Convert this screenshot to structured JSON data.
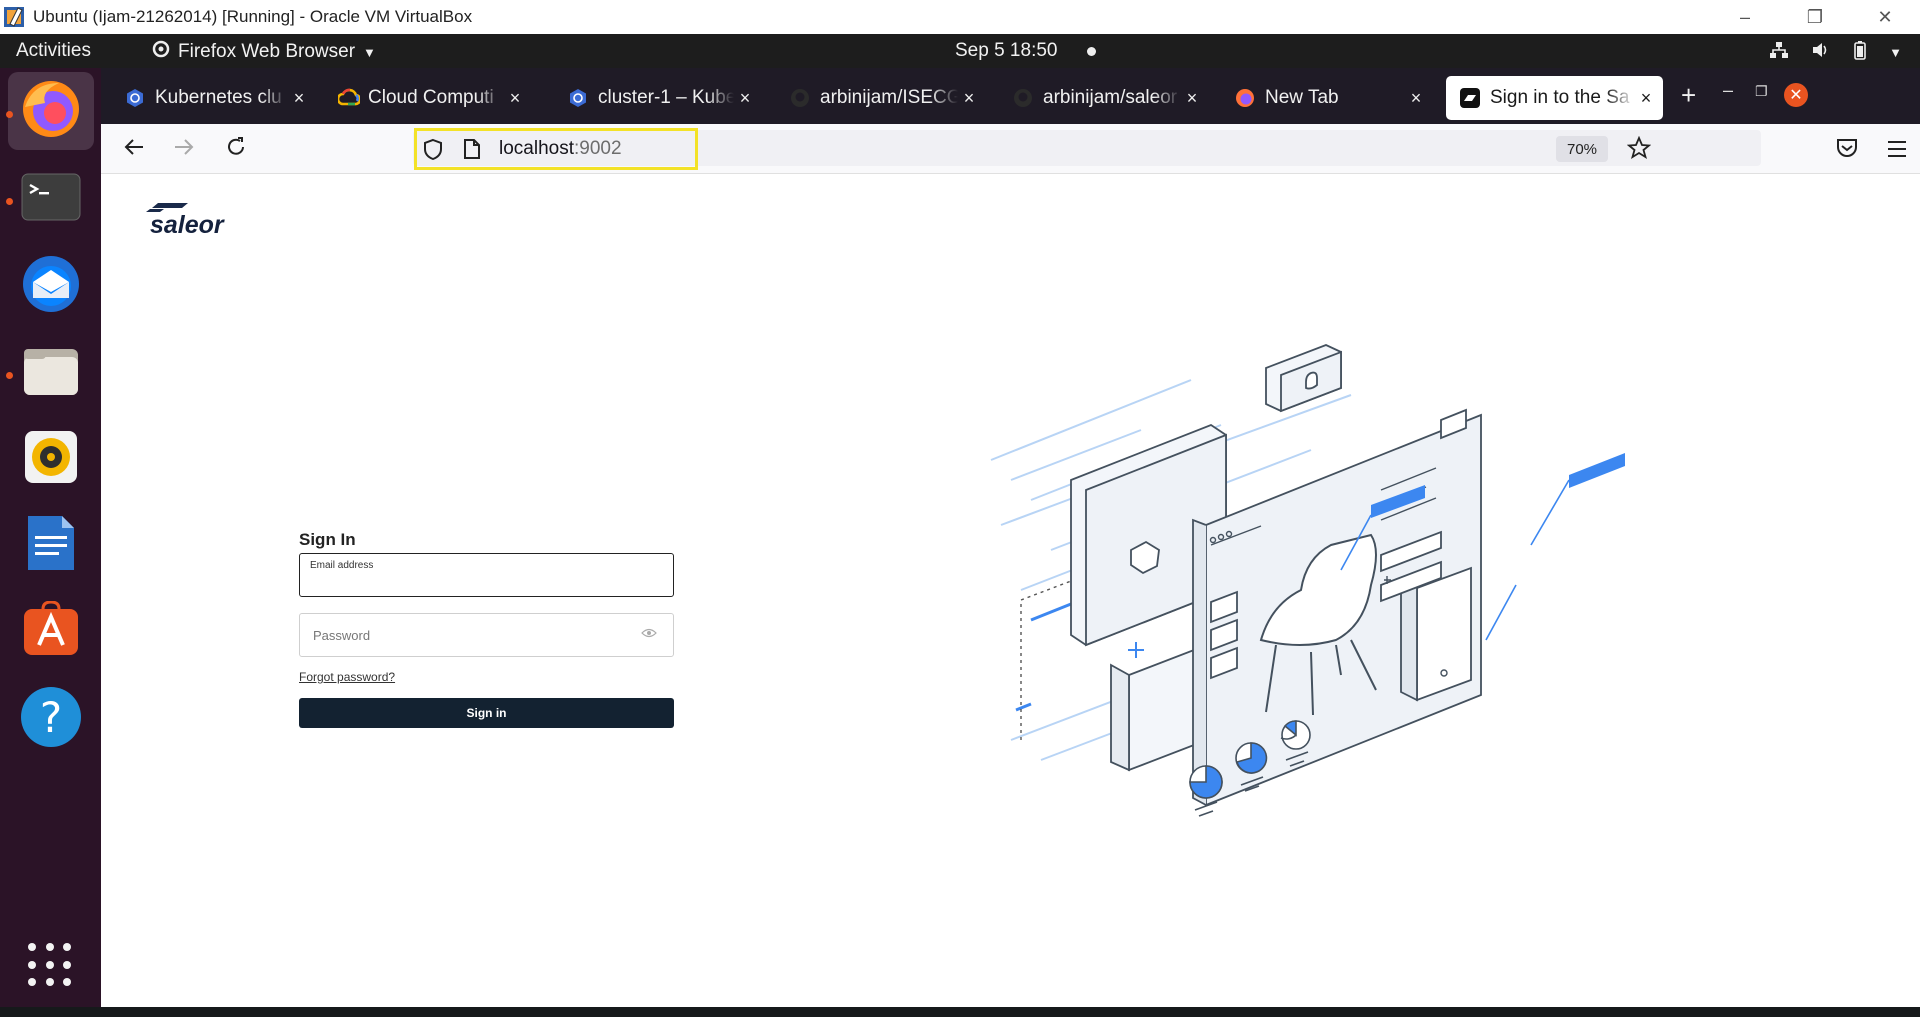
{
  "host_window": {
    "title": "Ubuntu (Ijam-21262014) [Running] - Oracle VM VirtualBox",
    "controls": [
      "–",
      "❐",
      "✕"
    ]
  },
  "ubuntu_topbar": {
    "activities": "Activities",
    "app_name": "Firefox Web Browser",
    "clock": "Sep 5  18:50"
  },
  "dock": {
    "items": [
      "firefox-icon",
      "terminal-icon",
      "thunderbird-icon",
      "files-icon",
      "rhythmbox-icon",
      "writer-icon",
      "app-center-icon",
      "help-icon"
    ],
    "help_glyph": "?"
  },
  "browser": {
    "tabs": [
      {
        "title": "Kubernetes clu",
        "favicon": "kubernetes-icon",
        "color": "#3b6bd4"
      },
      {
        "title": "Cloud Computi",
        "favicon": "gcloud-icon",
        "color": "#f4b400"
      },
      {
        "title": "cluster-1 – Kube",
        "favicon": "kubernetes-icon",
        "color": "#3b6bd4"
      },
      {
        "title": "arbinijam/ISECG",
        "favicon": "github-icon",
        "color": "#333333"
      },
      {
        "title": "arbinijam/saleor",
        "favicon": "github-icon",
        "color": "#333333"
      },
      {
        "title": "New Tab",
        "favicon": "firefox-icon",
        "color": "#ff7139"
      },
      {
        "title": "Sign in to the Sa",
        "favicon": "saleor-icon",
        "color": "#111111"
      }
    ],
    "close_glyph": "×",
    "new_tab_glyph": "+",
    "url_host": "localhost",
    "url_port": ":9002",
    "zoom": "70%"
  },
  "page": {
    "logo_text": "saleor",
    "heading": "Sign In",
    "email_label": "Email address",
    "password_placeholder": "Password",
    "forgot_link": "Forgot password?",
    "signin_button": "Sign in"
  },
  "colors": {
    "accent": "#3c87f0",
    "button_dark": "#132231",
    "ubuntu_orange": "#e95420",
    "url_highlight": "#f3e227"
  }
}
